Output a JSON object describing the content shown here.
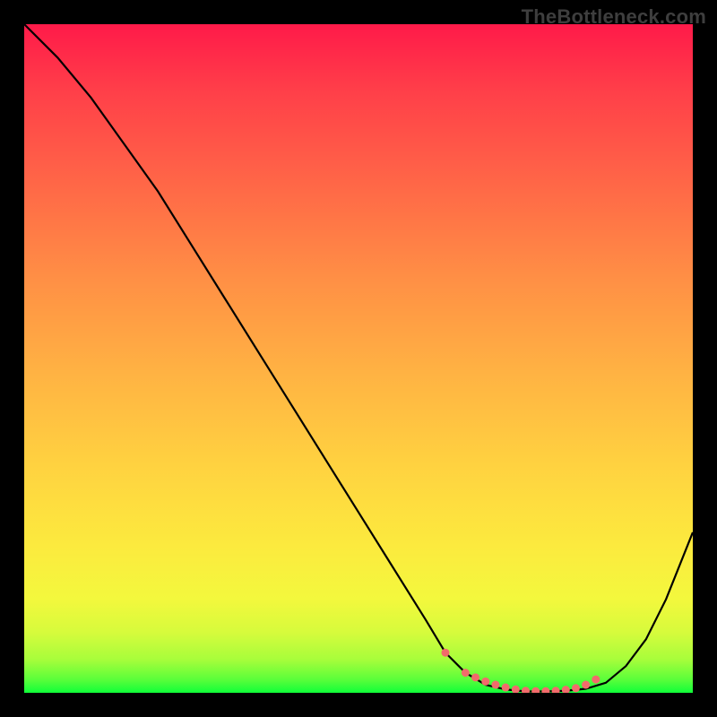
{
  "watermark": "TheBottleneck.com",
  "chart_data": {
    "type": "line",
    "title": "",
    "xlabel": "",
    "ylabel": "",
    "xlim": [
      0,
      100
    ],
    "ylim": [
      0,
      100
    ],
    "series": [
      {
        "name": "curve",
        "x": [
          0,
          5,
          10,
          15,
          20,
          25,
          30,
          35,
          40,
          45,
          50,
          55,
          60,
          63,
          66,
          69,
          72,
          75,
          78,
          81,
          84,
          87,
          90,
          93,
          96,
          100
        ],
        "y": [
          100,
          95,
          89,
          82,
          75,
          67,
          59,
          51,
          43,
          35,
          27,
          19,
          11,
          6,
          3,
          1.2,
          0.5,
          0.2,
          0.2,
          0.3,
          0.6,
          1.5,
          4,
          8,
          14,
          24
        ]
      },
      {
        "name": "highlight-dots",
        "x": [
          63,
          66,
          67.5,
          69,
          70.5,
          72,
          73.5,
          75,
          76.5,
          78,
          79.5,
          81,
          82.5,
          84,
          85.5
        ],
        "y": [
          6,
          3,
          2.3,
          1.7,
          1.2,
          0.8,
          0.5,
          0.3,
          0.25,
          0.25,
          0.3,
          0.45,
          0.7,
          1.2,
          2.0
        ]
      }
    ],
    "colors": {
      "gradient_top": "#ff1a49",
      "gradient_bottom": "#10ff39",
      "curve": "#000000",
      "dots": "#f26b6b"
    },
    "legend": false,
    "grid": false
  }
}
